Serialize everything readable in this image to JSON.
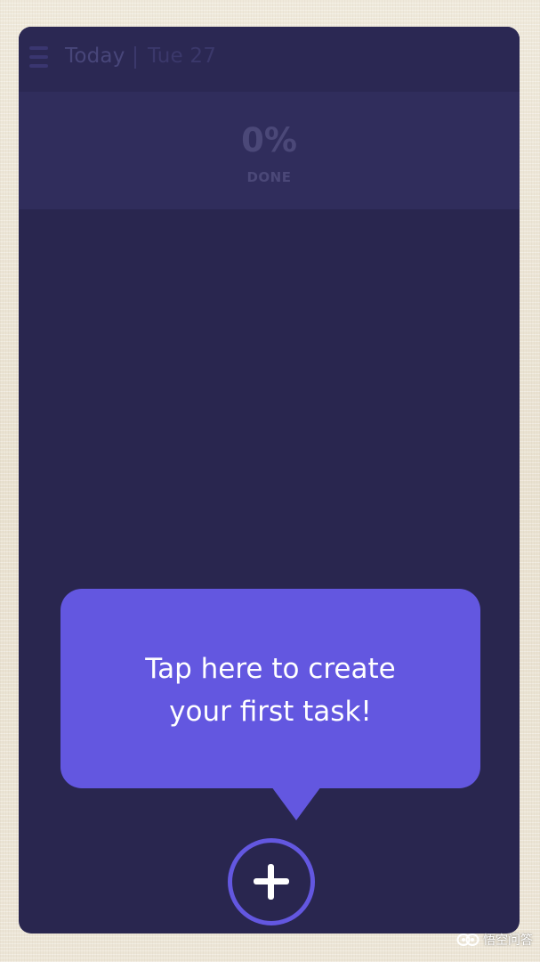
{
  "header": {
    "title": "Today",
    "date": "Tue 27",
    "menu_icon": "hamburger-menu-icon"
  },
  "progress": {
    "value": "0%",
    "label": "DONE"
  },
  "onboarding": {
    "tooltip_line1": "Tap here to create",
    "tooltip_line2": "your first task!"
  },
  "actions": {
    "add_icon": "plus-icon"
  },
  "watermark": {
    "text": "悟空问答"
  },
  "colors": {
    "background": "#29264f",
    "accent": "#6357e0",
    "header_text": "#48467a",
    "paper": "#ece5d6"
  }
}
